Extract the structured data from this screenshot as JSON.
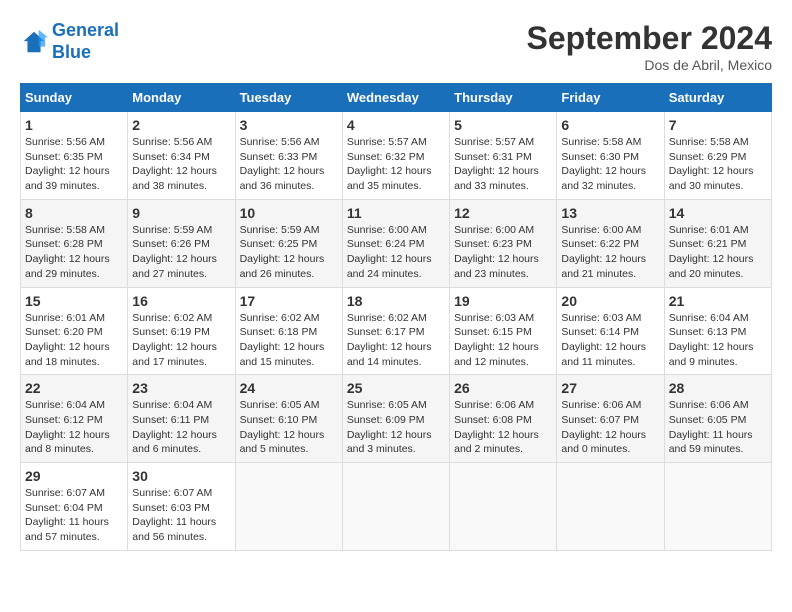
{
  "header": {
    "logo_line1": "General",
    "logo_line2": "Blue",
    "month": "September 2024",
    "location": "Dos de Abril, Mexico"
  },
  "weekdays": [
    "Sunday",
    "Monday",
    "Tuesday",
    "Wednesday",
    "Thursday",
    "Friday",
    "Saturday"
  ],
  "weeks": [
    [
      {
        "day": "1",
        "sunrise": "5:56 AM",
        "sunset": "6:35 PM",
        "daylight": "12 hours and 39 minutes."
      },
      {
        "day": "2",
        "sunrise": "5:56 AM",
        "sunset": "6:34 PM",
        "daylight": "12 hours and 38 minutes."
      },
      {
        "day": "3",
        "sunrise": "5:56 AM",
        "sunset": "6:33 PM",
        "daylight": "12 hours and 36 minutes."
      },
      {
        "day": "4",
        "sunrise": "5:57 AM",
        "sunset": "6:32 PM",
        "daylight": "12 hours and 35 minutes."
      },
      {
        "day": "5",
        "sunrise": "5:57 AM",
        "sunset": "6:31 PM",
        "daylight": "12 hours and 33 minutes."
      },
      {
        "day": "6",
        "sunrise": "5:58 AM",
        "sunset": "6:30 PM",
        "daylight": "12 hours and 32 minutes."
      },
      {
        "day": "7",
        "sunrise": "5:58 AM",
        "sunset": "6:29 PM",
        "daylight": "12 hours and 30 minutes."
      }
    ],
    [
      {
        "day": "8",
        "sunrise": "5:58 AM",
        "sunset": "6:28 PM",
        "daylight": "12 hours and 29 minutes."
      },
      {
        "day": "9",
        "sunrise": "5:59 AM",
        "sunset": "6:26 PM",
        "daylight": "12 hours and 27 minutes."
      },
      {
        "day": "10",
        "sunrise": "5:59 AM",
        "sunset": "6:25 PM",
        "daylight": "12 hours and 26 minutes."
      },
      {
        "day": "11",
        "sunrise": "6:00 AM",
        "sunset": "6:24 PM",
        "daylight": "12 hours and 24 minutes."
      },
      {
        "day": "12",
        "sunrise": "6:00 AM",
        "sunset": "6:23 PM",
        "daylight": "12 hours and 23 minutes."
      },
      {
        "day": "13",
        "sunrise": "6:00 AM",
        "sunset": "6:22 PM",
        "daylight": "12 hours and 21 minutes."
      },
      {
        "day": "14",
        "sunrise": "6:01 AM",
        "sunset": "6:21 PM",
        "daylight": "12 hours and 20 minutes."
      }
    ],
    [
      {
        "day": "15",
        "sunrise": "6:01 AM",
        "sunset": "6:20 PM",
        "daylight": "12 hours and 18 minutes."
      },
      {
        "day": "16",
        "sunrise": "6:02 AM",
        "sunset": "6:19 PM",
        "daylight": "12 hours and 17 minutes."
      },
      {
        "day": "17",
        "sunrise": "6:02 AM",
        "sunset": "6:18 PM",
        "daylight": "12 hours and 15 minutes."
      },
      {
        "day": "18",
        "sunrise": "6:02 AM",
        "sunset": "6:17 PM",
        "daylight": "12 hours and 14 minutes."
      },
      {
        "day": "19",
        "sunrise": "6:03 AM",
        "sunset": "6:15 PM",
        "daylight": "12 hours and 12 minutes."
      },
      {
        "day": "20",
        "sunrise": "6:03 AM",
        "sunset": "6:14 PM",
        "daylight": "12 hours and 11 minutes."
      },
      {
        "day": "21",
        "sunrise": "6:04 AM",
        "sunset": "6:13 PM",
        "daylight": "12 hours and 9 minutes."
      }
    ],
    [
      {
        "day": "22",
        "sunrise": "6:04 AM",
        "sunset": "6:12 PM",
        "daylight": "12 hours and 8 minutes."
      },
      {
        "day": "23",
        "sunrise": "6:04 AM",
        "sunset": "6:11 PM",
        "daylight": "12 hours and 6 minutes."
      },
      {
        "day": "24",
        "sunrise": "6:05 AM",
        "sunset": "6:10 PM",
        "daylight": "12 hours and 5 minutes."
      },
      {
        "day": "25",
        "sunrise": "6:05 AM",
        "sunset": "6:09 PM",
        "daylight": "12 hours and 3 minutes."
      },
      {
        "day": "26",
        "sunrise": "6:06 AM",
        "sunset": "6:08 PM",
        "daylight": "12 hours and 2 minutes."
      },
      {
        "day": "27",
        "sunrise": "6:06 AM",
        "sunset": "6:07 PM",
        "daylight": "12 hours and 0 minutes."
      },
      {
        "day": "28",
        "sunrise": "6:06 AM",
        "sunset": "6:05 PM",
        "daylight": "11 hours and 59 minutes."
      }
    ],
    [
      {
        "day": "29",
        "sunrise": "6:07 AM",
        "sunset": "6:04 PM",
        "daylight": "11 hours and 57 minutes."
      },
      {
        "day": "30",
        "sunrise": "6:07 AM",
        "sunset": "6:03 PM",
        "daylight": "11 hours and 56 minutes."
      },
      null,
      null,
      null,
      null,
      null
    ]
  ]
}
